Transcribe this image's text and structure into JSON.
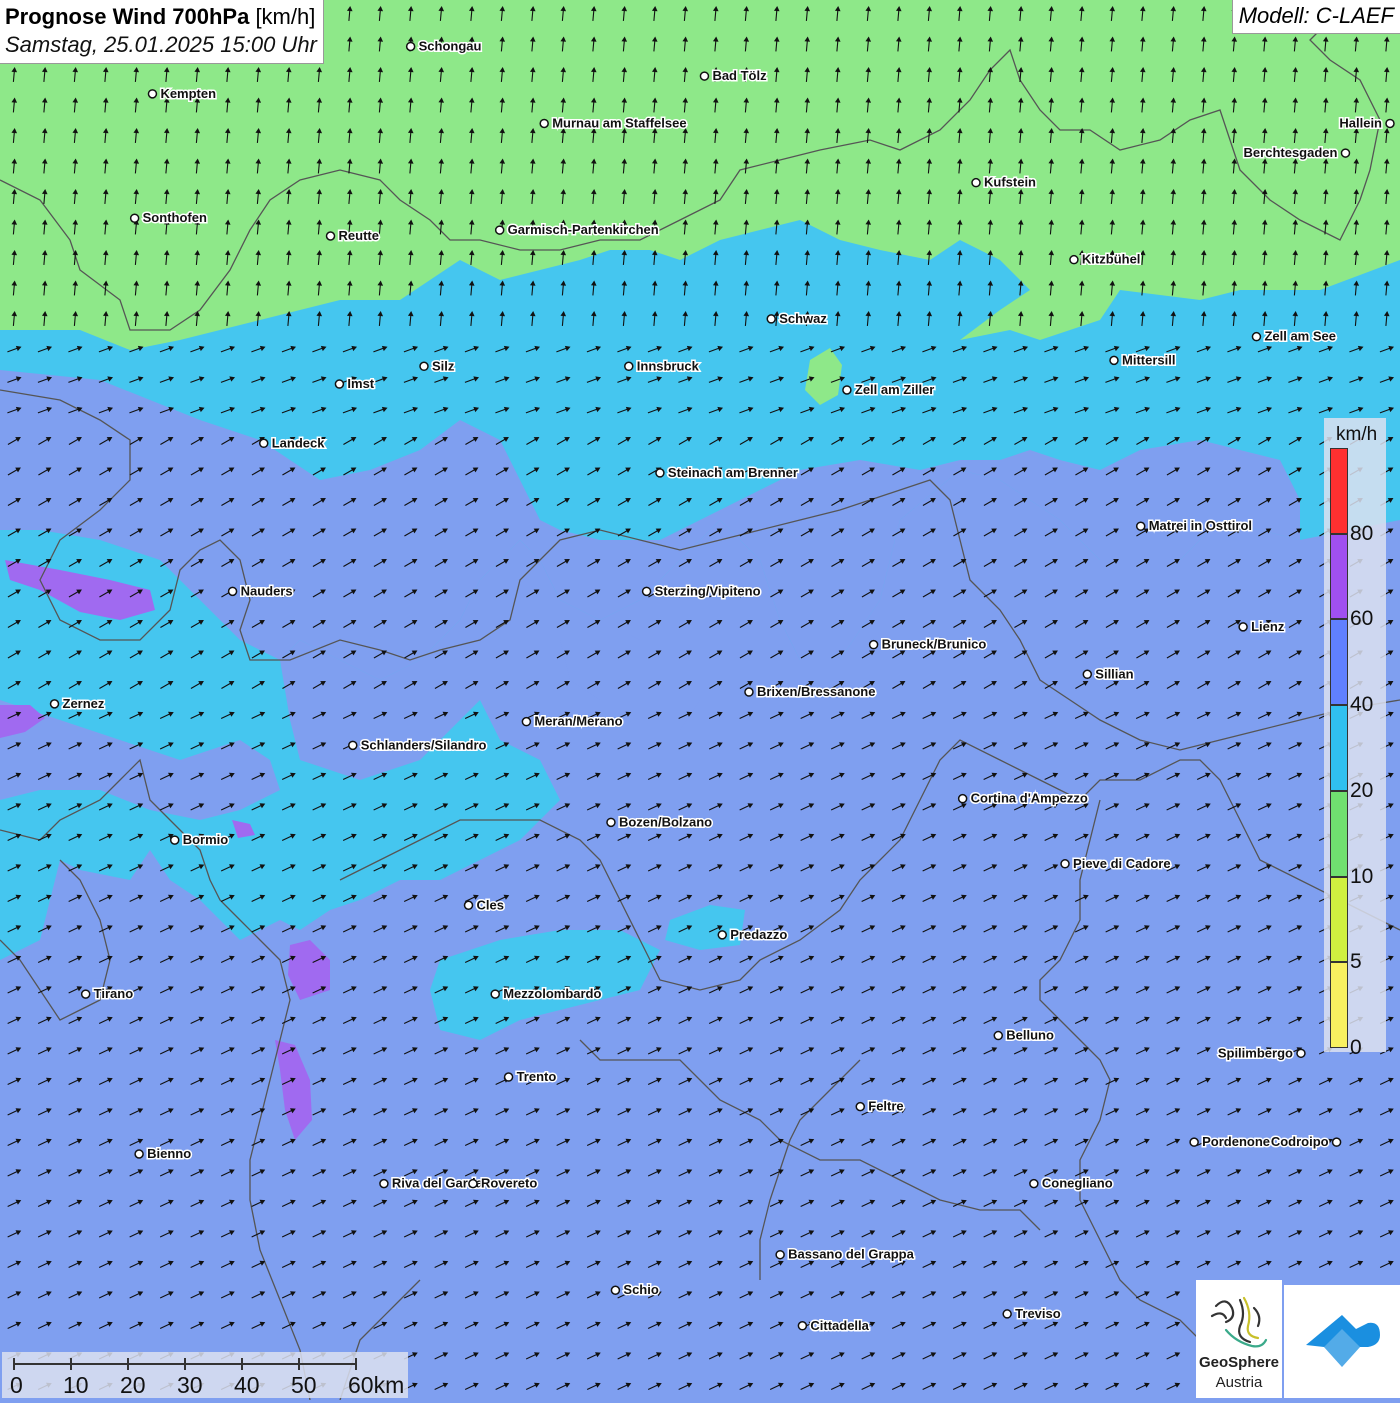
{
  "header": {
    "title_bold": "Prognose Wind 700hPa",
    "title_unit": "[km/h]",
    "datetime": "Samstag, 25.01.2025 15:00 Uhr",
    "model": "Modell: C-LAEF"
  },
  "legend": {
    "unit": "km/h",
    "ticks": [
      "80",
      "60",
      "40",
      "20",
      "10",
      "5",
      "0"
    ],
    "colors": [
      "#ff3030",
      "#a050f0",
      "#6080ff",
      "#30c0f0",
      "#70e070",
      "#d0f040",
      "#f8f060"
    ]
  },
  "scale": {
    "labels": [
      "0",
      "10",
      "20",
      "30",
      "40",
      "50",
      "60km"
    ]
  },
  "logo": {
    "name": "GeoSphere",
    "country": "Austria"
  },
  "colors": {
    "green_zone": "#8ee889",
    "cyan_zone": "#45c6ef",
    "blue_zone": "#7f9ff0",
    "purple_zone": "#a06af0",
    "border": "#555555"
  },
  "cities": [
    {
      "name": "Schongau",
      "lon": 10.9,
      "lat": 47.81
    },
    {
      "name": "Bad Tölz",
      "lon": 11.56,
      "lat": 47.76
    },
    {
      "name": "Kempten",
      "lon": 10.32,
      "lat": 47.73
    },
    {
      "name": "Murnau am Staffelsee",
      "lon": 11.2,
      "lat": 47.68
    },
    {
      "name": "Hallein",
      "lon": 13.1,
      "lat": 47.68
    },
    {
      "name": "Berchtesgaden",
      "lon": 13.0,
      "lat": 47.63
    },
    {
      "name": "Kufstein",
      "lon": 12.17,
      "lat": 47.58
    },
    {
      "name": "Sonthofen",
      "lon": 10.28,
      "lat": 47.52
    },
    {
      "name": "Reutte",
      "lon": 10.72,
      "lat": 47.49
    },
    {
      "name": "Garmisch-Partenkirchen",
      "lon": 11.1,
      "lat": 47.5
    },
    {
      "name": "Kitzbühel",
      "lon": 12.39,
      "lat": 47.45
    },
    {
      "name": "Schwaz",
      "lon": 11.71,
      "lat": 47.35
    },
    {
      "name": "Zell am See",
      "lon": 12.8,
      "lat": 47.32
    },
    {
      "name": "Mittersill",
      "lon": 12.48,
      "lat": 47.28
    },
    {
      "name": "Innsbruck",
      "lon": 11.39,
      "lat": 47.27
    },
    {
      "name": "Silz",
      "lon": 10.93,
      "lat": 47.27
    },
    {
      "name": "Imst",
      "lon": 10.74,
      "lat": 47.24
    },
    {
      "name": "Zell am Ziller",
      "lon": 11.88,
      "lat": 47.23
    },
    {
      "name": "Landeck",
      "lon": 10.57,
      "lat": 47.14
    },
    {
      "name": "Steinach am Brenner",
      "lon": 11.46,
      "lat": 47.09
    },
    {
      "name": "Matrei in Osttirol",
      "lon": 12.54,
      "lat": 47.0
    },
    {
      "name": "Nauders",
      "lon": 10.5,
      "lat": 46.89
    },
    {
      "name": "Sterzing/Vipiteno",
      "lon": 11.43,
      "lat": 46.89
    },
    {
      "name": "Lienz",
      "lon": 12.77,
      "lat": 46.83
    },
    {
      "name": "Bruneck/Brunico",
      "lon": 11.94,
      "lat": 46.8
    },
    {
      "name": "Sillian",
      "lon": 12.42,
      "lat": 46.75
    },
    {
      "name": "Brixen/Bressanone",
      "lon": 11.66,
      "lat": 46.72
    },
    {
      "name": "Zernez",
      "lon": 10.1,
      "lat": 46.7
    },
    {
      "name": "Meran/Merano",
      "lon": 11.16,
      "lat": 46.67
    },
    {
      "name": "Schlanders/Silandro",
      "lon": 10.77,
      "lat": 46.63
    },
    {
      "name": "Cortina d'Ampezzo",
      "lon": 12.14,
      "lat": 46.54
    },
    {
      "name": "Bozen/Bolzano",
      "lon": 11.35,
      "lat": 46.5
    },
    {
      "name": "Bormio",
      "lon": 10.37,
      "lat": 46.47
    },
    {
      "name": "Pieve di Cadore",
      "lon": 12.37,
      "lat": 46.43
    },
    {
      "name": "Cles",
      "lon": 11.03,
      "lat": 46.36
    },
    {
      "name": "Predazzo",
      "lon": 11.6,
      "lat": 46.31
    },
    {
      "name": "Tirano",
      "lon": 10.17,
      "lat": 46.21
    },
    {
      "name": "Mezzolombardo",
      "lon": 11.09,
      "lat": 46.21
    },
    {
      "name": "Belluno",
      "lon": 12.22,
      "lat": 46.14
    },
    {
      "name": "Spilimbergo",
      "lon": 12.9,
      "lat": 46.11
    },
    {
      "name": "Trento",
      "lon": 11.12,
      "lat": 46.07
    },
    {
      "name": "Feltre",
      "lon": 11.91,
      "lat": 46.02
    },
    {
      "name": "Pordenone",
      "lon": 12.66,
      "lat": 45.96
    },
    {
      "name": "Codroipo",
      "lon": 12.98,
      "lat": 45.96
    },
    {
      "name": "Bienno",
      "lon": 10.29,
      "lat": 45.94
    },
    {
      "name": "Riva del Garda",
      "lon": 10.84,
      "lat": 45.89
    },
    {
      "name": "Rovereto",
      "lon": 11.04,
      "lat": 45.89
    },
    {
      "name": "Conegliano",
      "lon": 12.3,
      "lat": 45.89
    },
    {
      "name": "Bassano del Grappa",
      "lon": 11.73,
      "lat": 45.77
    },
    {
      "name": "Schio",
      "lon": 11.36,
      "lat": 45.71
    },
    {
      "name": "Treviso",
      "lon": 12.24,
      "lat": 45.67
    },
    {
      "name": "Cittadella",
      "lon": 11.78,
      "lat": 45.65
    }
  ]
}
